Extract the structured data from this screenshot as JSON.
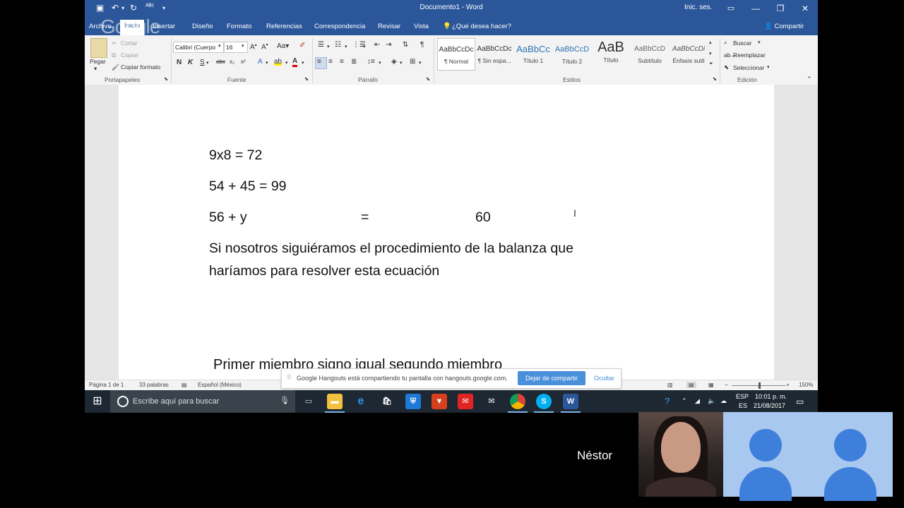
{
  "titlebar": {
    "title": "Documento1 - Word",
    "sign_in": "Inic. ses."
  },
  "tabs": {
    "archivo": "Archivo",
    "inicio": "Inicio",
    "insertar": "Insertar",
    "diseno": "Diseño",
    "formato": "Formato",
    "referencias": "Referencias",
    "correspondencia": "Correspondencia",
    "revisar": "Revisar",
    "vista": "Vista",
    "tell_me": "¿Qué desea hacer?",
    "share": "Compartir",
    "watermark": "Google"
  },
  "ribbon": {
    "clipboard": {
      "paste": "Pegar",
      "cut": "Cortar",
      "copy": "Copiar",
      "format_painter": "Copiar formato",
      "label": "Portapapeles"
    },
    "font": {
      "font_name": "Calibri (Cuerpo",
      "font_size": "16",
      "label": "Fuente"
    },
    "paragraph": {
      "label": "Párrafo"
    },
    "styles": {
      "label": "Estilos",
      "items": [
        {
          "preview": "AaBbCcDc",
          "name": "¶ Normal"
        },
        {
          "preview": "AaBbCcDc",
          "name": "¶ Sin espa..."
        },
        {
          "preview": "AaBbCc",
          "name": "Título 1"
        },
        {
          "preview": "AaBbCcD",
          "name": "Título 2"
        },
        {
          "preview": "AaB",
          "name": "Título"
        },
        {
          "preview": "AaBbCcD",
          "name": "Subtítulo"
        },
        {
          "preview": "AaBbCcDi",
          "name": "Énfasis sutil"
        }
      ]
    },
    "editing": {
      "find": "Buscar",
      "replace": "Reemplazar",
      "select": "Seleccionar",
      "label": "Edición"
    }
  },
  "document": {
    "line1": "9x8 = 72",
    "line2": "54 + 45 = 99",
    "line3_left": "56 + y",
    "line3_eq": "=",
    "line3_right": "60",
    "para_line1": "Si nosotros siguiéramos el procedimiento de la balanza que",
    "para_line2": "haríamos para resolver esta ecuación",
    "partial_line": "Primer miembro signo igual segundo miembro"
  },
  "statusbar": {
    "page": "Página 1 de 1",
    "words": "33 palabras",
    "language": "Español (México)",
    "zoom": "150%"
  },
  "hangouts": {
    "message": "Google Hangouts está compartiendo tu pantalla con hangouts.google.com.",
    "stop": "Dejar de compartir",
    "hide": "Ocultar"
  },
  "taskbar": {
    "search_placeholder": "Escribe aquí para buscar",
    "lang_top": "ESP",
    "lang_bottom": "ES",
    "time": "10:01 p. m.",
    "date": "21/08/2017"
  },
  "call": {
    "name": "Néstor"
  },
  "colors": {
    "word_blue": "#2b579a",
    "taskbar": "#1e2832",
    "avatar_blue": "#3f7fdc",
    "tile_bg": "#a9c8f0"
  }
}
